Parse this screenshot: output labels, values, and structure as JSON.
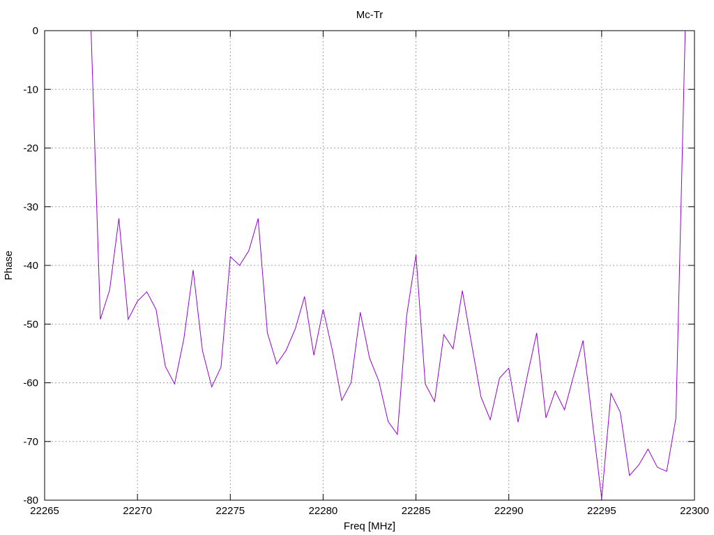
{
  "chart_data": {
    "type": "line",
    "title": "Mc-Tr",
    "xlabel": "Freq [MHz]",
    "ylabel": "Phase",
    "xlim": [
      22265,
      22300
    ],
    "ylim": [
      -80,
      0
    ],
    "xticks": [
      22265,
      22270,
      22275,
      22280,
      22285,
      22290,
      22295,
      22300
    ],
    "yticks": [
      0,
      -10,
      -20,
      -30,
      -40,
      -50,
      -60,
      -70,
      -80
    ],
    "grid": true,
    "line_color": "#9400d3",
    "series": [
      {
        "x": [
          22267.5,
          22268.0,
          22268.5,
          22269.0,
          22269.5,
          22270.0,
          22270.5,
          22271.0,
          22271.5,
          22272.0,
          22272.5,
          22273.0,
          22273.5,
          22274.0,
          22274.5,
          22275.0,
          22275.5,
          22276.0,
          22276.5,
          22277.0,
          22277.5,
          22278.0,
          22278.5,
          22279.0,
          22279.5,
          22280.0,
          22280.5,
          22281.0,
          22281.5,
          22282.0,
          22282.5,
          22283.0,
          22283.5,
          22284.0,
          22284.5,
          22285.0,
          22285.5,
          22286.0,
          22286.5,
          22287.0,
          22287.5,
          22288.0,
          22288.5,
          22289.0,
          22289.5,
          22290.0,
          22290.5,
          22291.0,
          22291.5,
          22292.0,
          22292.5,
          22293.0,
          22293.5,
          22294.0,
          22294.5,
          22295.0,
          22295.5,
          22296.0,
          22296.5,
          22297.0,
          22297.5,
          22298.0,
          22298.5,
          22299.0,
          22299.5
        ],
        "y": [
          0,
          -49.2,
          -44.2,
          -32.0,
          -49.2,
          -46.1,
          -44.5,
          -47.5,
          -57.2,
          -60.2,
          -52.5,
          -40.8,
          -54.5,
          -60.7,
          -57.3,
          -38.5,
          -40.0,
          -37.5,
          -32.0,
          -51.5,
          -56.8,
          -54.5,
          -50.8,
          -45.3,
          -55.3,
          -47.5,
          -54.5,
          -63.0,
          -60.0,
          -48.0,
          -55.8,
          -59.7,
          -66.6,
          -68.8,
          -48.5,
          -38.2,
          -60.2,
          -63.2,
          -51.8,
          -54.2,
          -44.3,
          -53.5,
          -62.4,
          -66.3,
          -59.2,
          -57.5,
          -66.7,
          -58.8,
          -51.5,
          -66.0,
          -61.4,
          -64.6,
          -58.7,
          -52.8,
          -66.5,
          -79.7,
          -61.8,
          -65.0,
          -75.8,
          -74.0,
          -71.3,
          -74.4,
          -75.1,
          -66.0,
          0
        ]
      }
    ]
  }
}
